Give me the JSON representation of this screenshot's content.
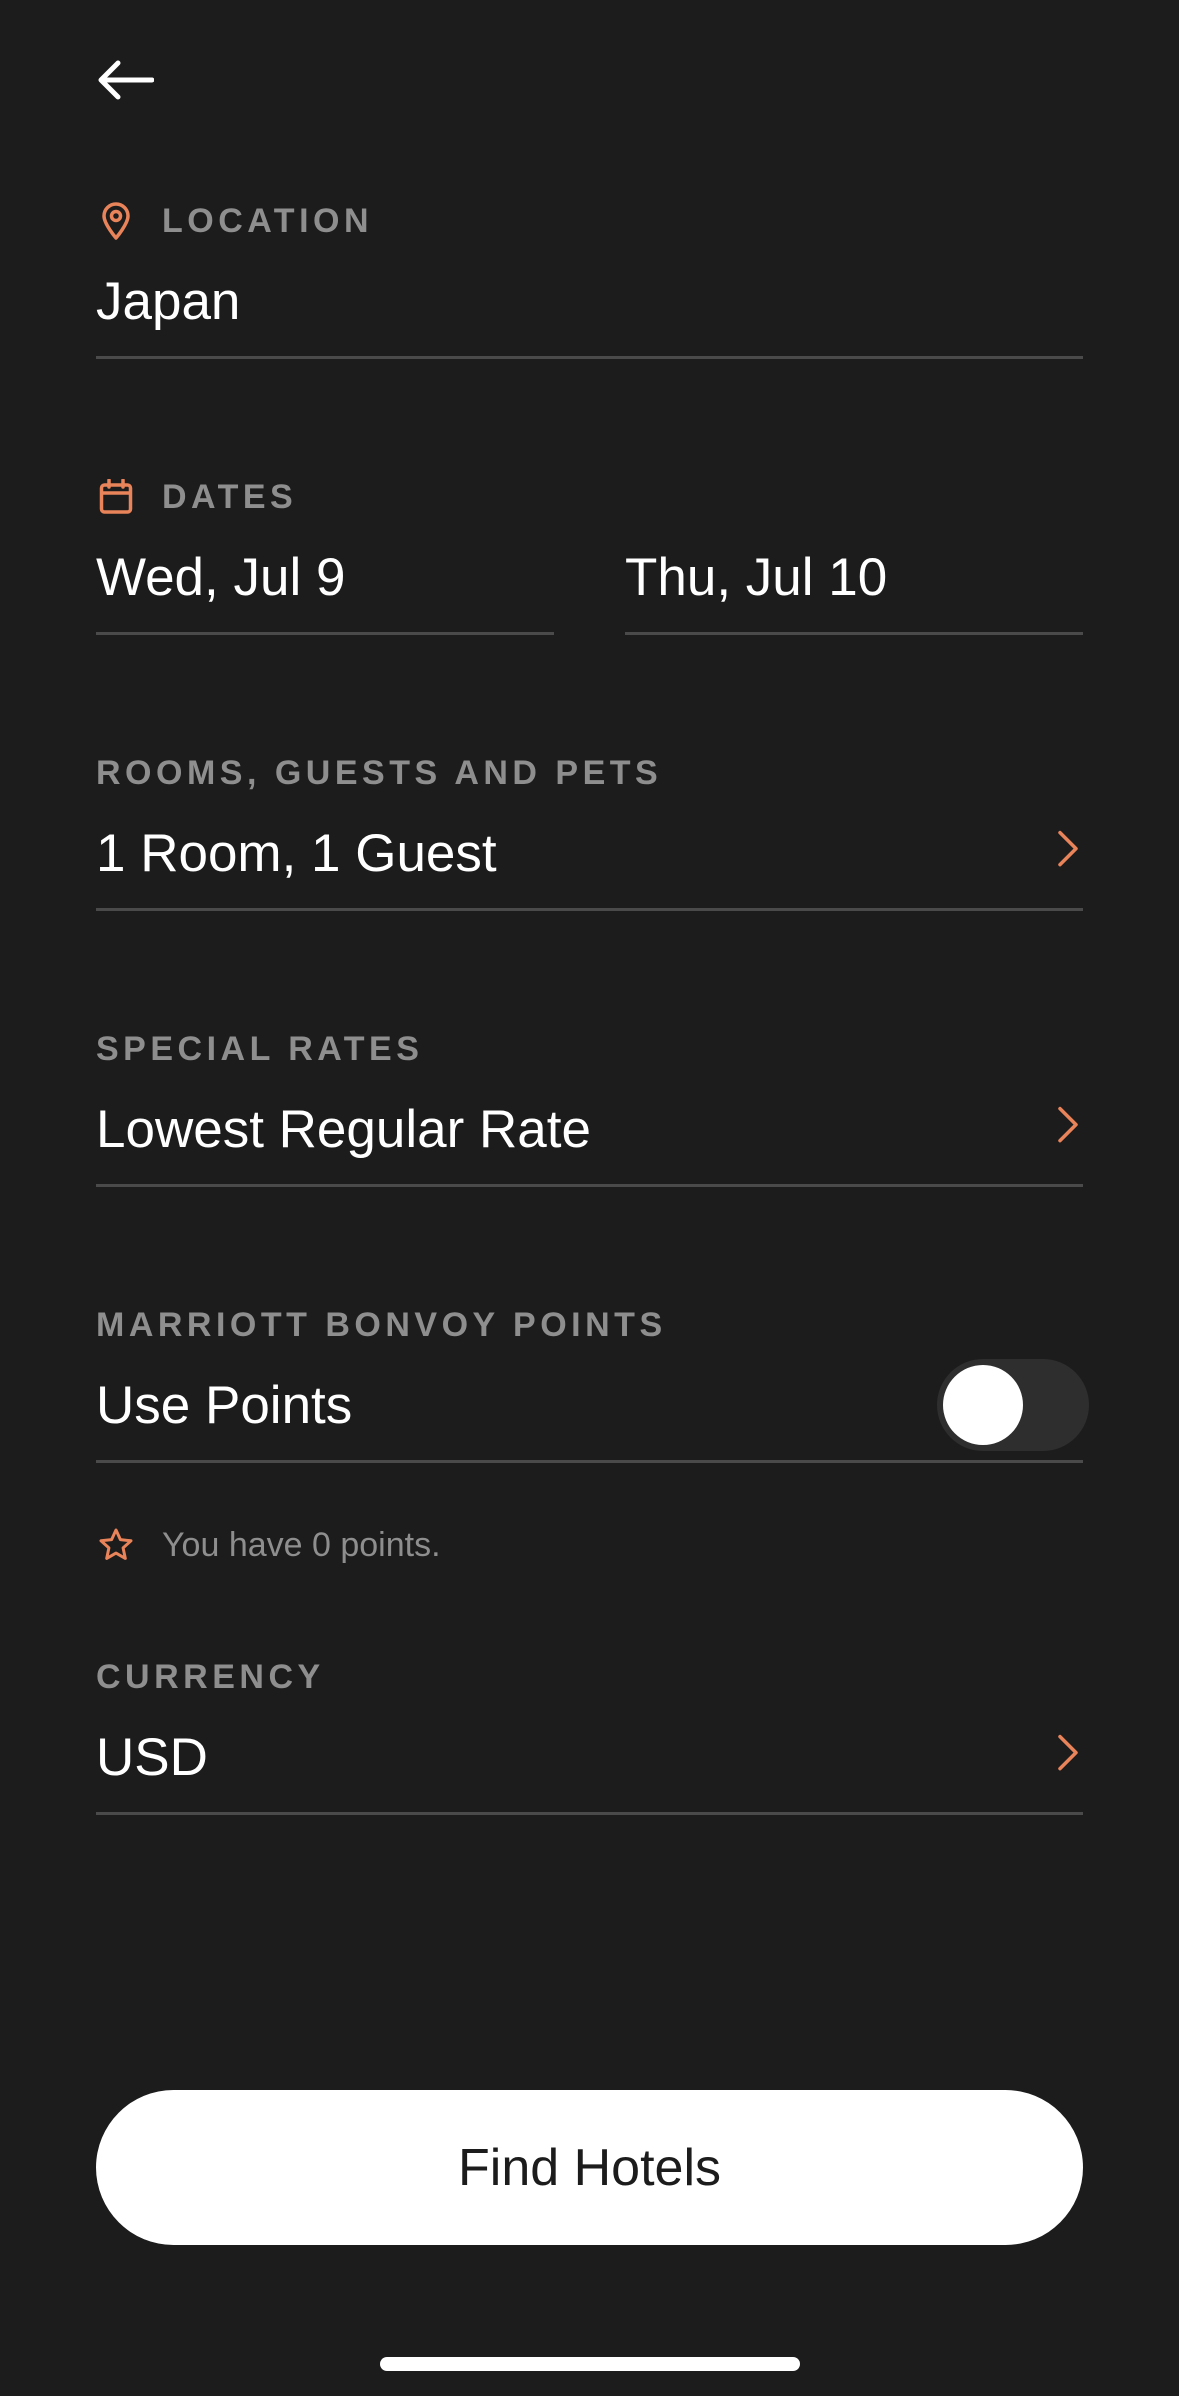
{
  "colors": {
    "background": "#1c1c1c",
    "accent": "#e8835a",
    "label": "#8e8e8e",
    "divider": "#4a4a4a"
  },
  "header": {
    "back_icon": "arrow-left-icon"
  },
  "location": {
    "icon": "map-pin-icon",
    "label": "LOCATION",
    "value": "Japan"
  },
  "dates": {
    "icon": "calendar-icon",
    "label": "DATES",
    "check_in": "Wed, Jul 9",
    "check_out": "Thu, Jul 10"
  },
  "rooms": {
    "label": "ROOMS, GUESTS AND PETS",
    "value": "1 Room, 1 Guest",
    "icon": "chevron-right-icon"
  },
  "special_rates": {
    "label": "SPECIAL RATES",
    "value": "Lowest Regular Rate",
    "icon": "chevron-right-icon"
  },
  "points": {
    "label": "MARRIOTT BONVOY POINTS",
    "value": "Use Points",
    "toggle_on": false,
    "note_icon": "star-icon",
    "note": "You have 0 points."
  },
  "currency": {
    "label": "CURRENCY",
    "value": "USD",
    "icon": "chevron-right-icon"
  },
  "actions": {
    "find_label": "Find Hotels"
  }
}
